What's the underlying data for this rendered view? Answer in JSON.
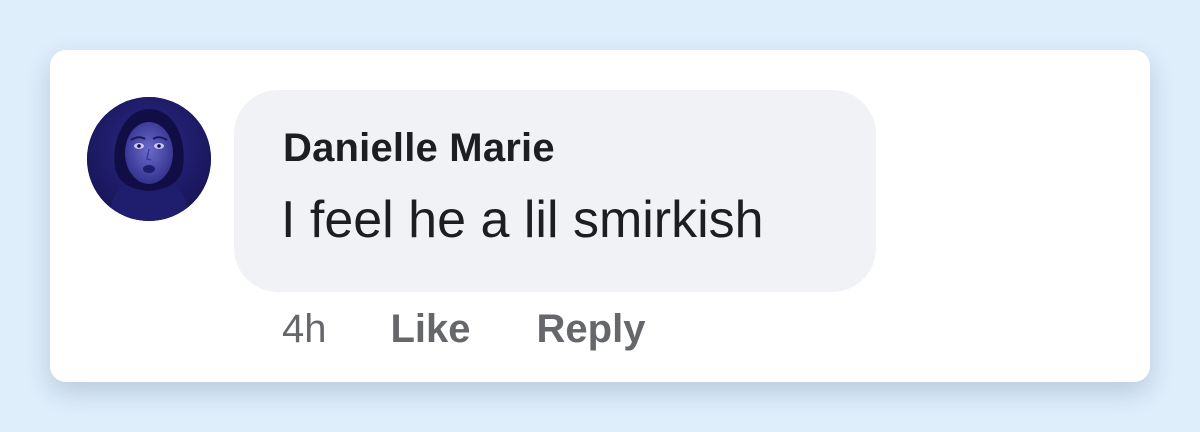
{
  "comment": {
    "author": "Danielle Marie",
    "text": "I feel he a lil smirkish",
    "timestamp": "4h",
    "actions": {
      "like_label": "Like",
      "reply_label": "Reply"
    }
  },
  "colors": {
    "page_background": "#deeefb",
    "card_background": "#ffffff",
    "bubble_background": "#f0f2f5",
    "author_text": "#1c1e21",
    "secondary_text": "#65676b",
    "avatar_background": "#1b1a63"
  }
}
